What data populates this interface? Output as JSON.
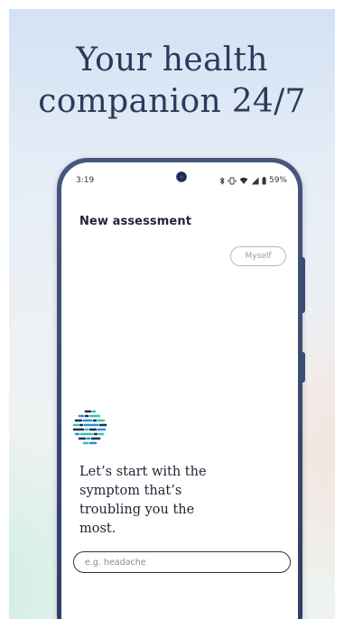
{
  "headline": [
    "Your health",
    "companion 24/7"
  ],
  "status_bar": {
    "time": "3:19",
    "battery": "59%",
    "icons": [
      "bluetooth-icon",
      "vibrate-icon",
      "wifi-icon",
      "signal-icon",
      "battery-icon"
    ]
  },
  "screen": {
    "title": "New assessment",
    "chip_label": "Myself",
    "prompt": "Let’s start with the symptom that’s troubling you the most.",
    "input": {
      "value": "",
      "placeholder": "e.g. headache"
    }
  },
  "colors": {
    "headline": "#2b3a5c",
    "phone_frame": "#3a4a72",
    "logo_teal": "#35c3b0",
    "logo_blue": "#2f8fd8",
    "logo_dark": "#1f2f5a"
  }
}
